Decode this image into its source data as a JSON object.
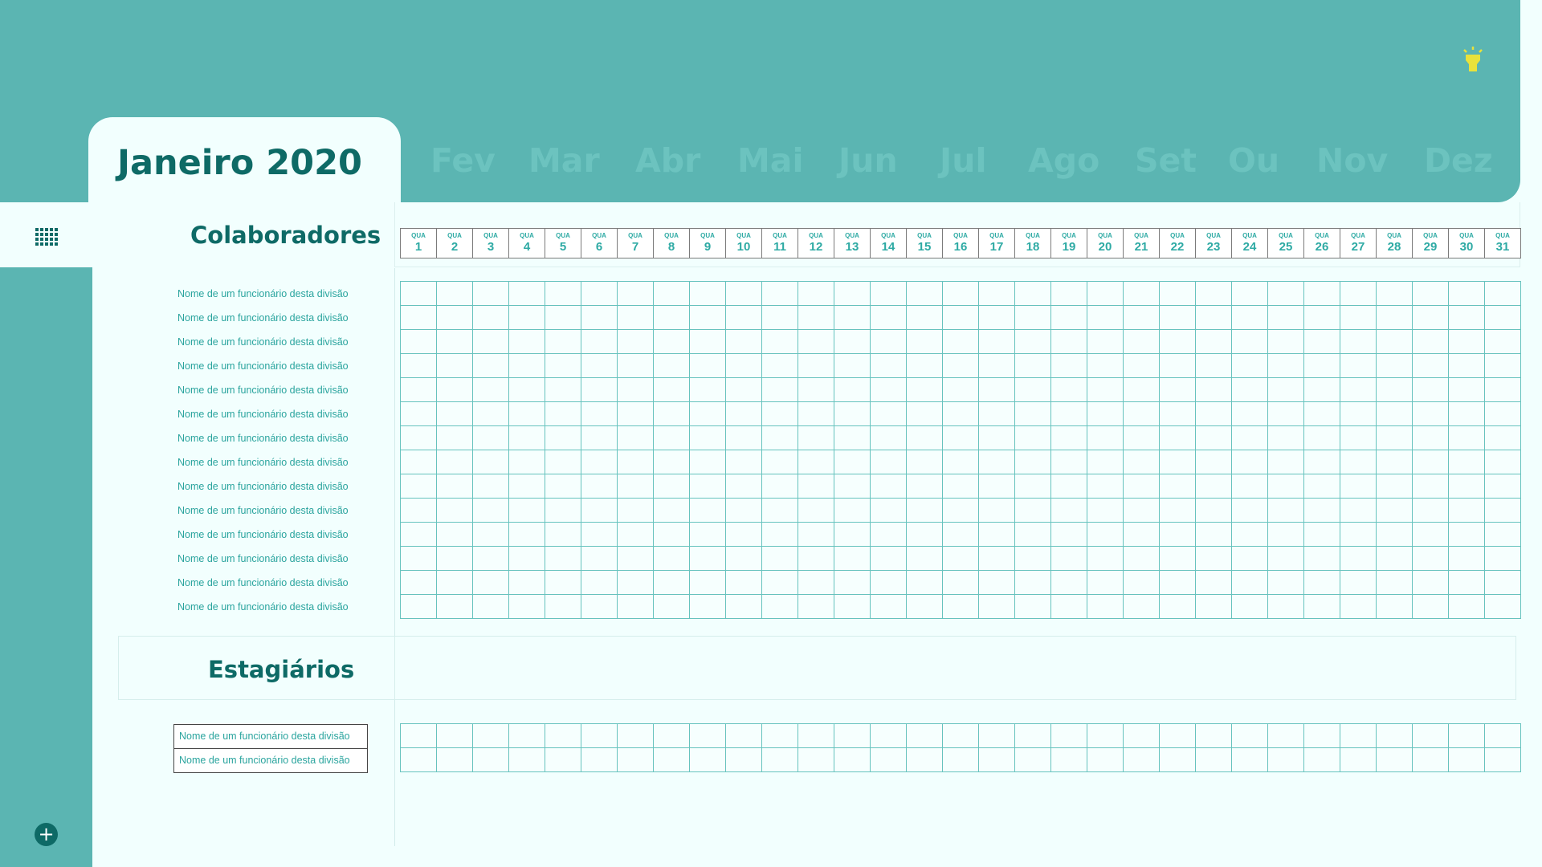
{
  "header": {
    "active_month": "Janeiro 2020",
    "months": [
      "Fev",
      "Mar",
      "Abr",
      "Mai",
      "Jun",
      "Jul",
      "Ago",
      "Set",
      "Ou",
      "Nov",
      "Dez"
    ],
    "bulb_icon": "lightbulb-icon"
  },
  "colors": {
    "header_bg": "#5bb5b2",
    "title": "#0e6a66",
    "inactive_month": "#6cc3bf",
    "grid_line": "#66c3be",
    "bulb": "#e9e23b"
  },
  "sidebar": {
    "grid_icon": "grid-view-icon",
    "add_icon": "add-icon"
  },
  "colaboradores": {
    "title": "Colaboradores",
    "days": [
      {
        "wd": "QUA",
        "n": "1"
      },
      {
        "wd": "QUA",
        "n": "2"
      },
      {
        "wd": "QUA",
        "n": "3"
      },
      {
        "wd": "QUA",
        "n": "4"
      },
      {
        "wd": "QUA",
        "n": "5"
      },
      {
        "wd": "QUA",
        "n": "6"
      },
      {
        "wd": "QUA",
        "n": "7"
      },
      {
        "wd": "QUA",
        "n": "8"
      },
      {
        "wd": "QUA",
        "n": "9"
      },
      {
        "wd": "QUA",
        "n": "10"
      },
      {
        "wd": "QUA",
        "n": "11"
      },
      {
        "wd": "QUA",
        "n": "12"
      },
      {
        "wd": "QUA",
        "n": "13"
      },
      {
        "wd": "QUA",
        "n": "14"
      },
      {
        "wd": "QUA",
        "n": "15"
      },
      {
        "wd": "QUA",
        "n": "16"
      },
      {
        "wd": "QUA",
        "n": "17"
      },
      {
        "wd": "QUA",
        "n": "18"
      },
      {
        "wd": "QUA",
        "n": "19"
      },
      {
        "wd": "QUA",
        "n": "20"
      },
      {
        "wd": "QUA",
        "n": "21"
      },
      {
        "wd": "QUA",
        "n": "22"
      },
      {
        "wd": "QUA",
        "n": "23"
      },
      {
        "wd": "QUA",
        "n": "24"
      },
      {
        "wd": "QUA",
        "n": "25"
      },
      {
        "wd": "QUA",
        "n": "26"
      },
      {
        "wd": "QUA",
        "n": "27"
      },
      {
        "wd": "QUA",
        "n": "28"
      },
      {
        "wd": "QUA",
        "n": "29"
      },
      {
        "wd": "QUA",
        "n": "30"
      },
      {
        "wd": "QUA",
        "n": "31"
      }
    ],
    "employees": [
      "Nome de um funcionário desta divisão",
      "Nome de um funcionário desta divisão",
      "Nome de um funcionário desta divisão",
      "Nome de um funcionário desta divisão",
      "Nome de um funcionário desta divisão",
      "Nome de um funcionário desta divisão",
      "Nome de um funcionário desta divisão",
      "Nome de um funcionário desta divisão",
      "Nome de um funcionário desta divisão",
      "Nome de um funcionário desta divisão",
      "Nome de um funcionário desta divisão",
      "Nome de um funcionário desta divisão",
      "Nome de um funcionário desta divisão",
      "Nome de um funcionário desta divisão"
    ]
  },
  "estagiarios": {
    "title": "Estagiários",
    "interns": [
      "Nome de um funcionário desta divisão",
      "Nome de um funcionário desta divisão"
    ]
  }
}
